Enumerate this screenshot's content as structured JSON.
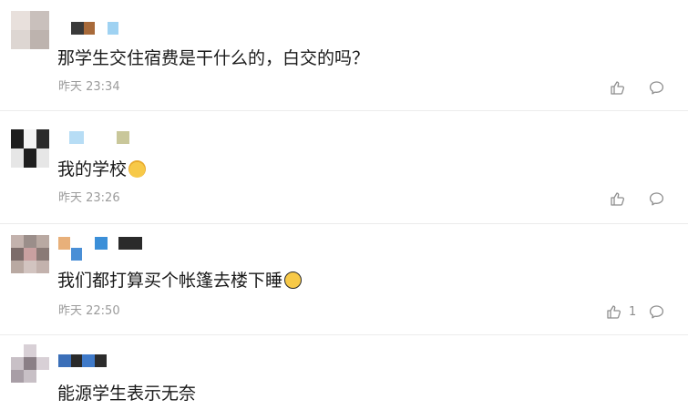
{
  "comments": [
    {
      "text": "那学生交住宿费是干什么的，白交的吗？",
      "time": "昨天 23:34",
      "likes": "",
      "avatar_colors": [
        "#e8e0dc",
        "#c9c0bc",
        "#ddd6d2",
        "#bdb3ae"
      ],
      "name_colors": [
        "#3a3a3a",
        "#a86a3a",
        "#9fd2f2"
      ]
    },
    {
      "text": "我的学校",
      "emoji": "laughing-emoji",
      "time": "昨天 23:26",
      "likes": "",
      "avatar_colors": [
        "#1e1e1e",
        "#f3f3f3",
        "#2b2b2b",
        "#e6e6e6"
      ],
      "name_colors": [
        "#b7ddf5",
        "#c9c79a"
      ]
    },
    {
      "text": "我们都打算买个帐篷去楼下睡",
      "emoji": "upside-down-face-emoji",
      "time": "昨天 22:50",
      "likes": "1",
      "avatar_colors": [
        "#9b8e8a",
        "#b9a9a2",
        "#7c6c6a",
        "#c3b2ad"
      ],
      "name_colors": [
        "#e8b07a",
        "#4a8fd6",
        "#3b8fd8",
        "#2a2a2a"
      ]
    },
    {
      "text": "能源学生表示无奈",
      "time": "",
      "likes": "",
      "avatar_colors": [
        "#d8d0d6",
        "#8a7f86",
        "#c8c0c6",
        "#a89ea6"
      ],
      "name_colors": [
        "#3b6fb8",
        "#2a2a2a",
        "#3f7ac9",
        "#2c2c2c"
      ]
    }
  ],
  "colors": {
    "text": "#1a1a1a",
    "meta": "#9b9b9b",
    "icon": "#8e8e8e",
    "divider": "#ececec"
  },
  "icons": {
    "like": "thumbs-up-icon",
    "reply": "comment-bubble-icon"
  }
}
